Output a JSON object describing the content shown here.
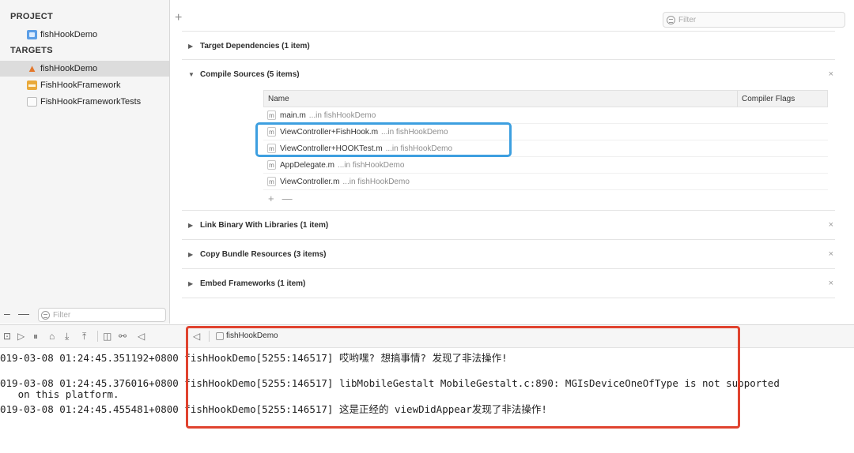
{
  "navigator": {
    "project_header": "PROJECT",
    "project_item": "fishHookDemo",
    "targets_header": "TARGETS",
    "targets": [
      {
        "label": "fishHookDemo",
        "icon": "app-target-icon"
      },
      {
        "label": "FishHookFramework",
        "icon": "framework-icon"
      },
      {
        "label": "FishHookFrameworkTests",
        "icon": "test-bundle-icon"
      }
    ],
    "filter_placeholder": "Filter"
  },
  "editor": {
    "add_symbol": "+",
    "filter_placeholder": "Filter",
    "phases": {
      "target_dependencies": "Target Dependencies (1 item)",
      "compile_sources": "Compile Sources (5 items)",
      "link_binary": "Link Binary With Libraries (1 item)",
      "copy_bundle": "Copy Bundle Resources (3 items)",
      "embed_frameworks": "Embed Frameworks (1 item)"
    },
    "close_symbol": "×",
    "table": {
      "col_name": "Name",
      "col_flags": "Compiler Flags",
      "rows": [
        {
          "file": "main.m",
          "location": "...in fishHookDemo"
        },
        {
          "file": "ViewController+FishHook.m",
          "location": "...in fishHookDemo"
        },
        {
          "file": "ViewController+HOOKTest.m",
          "location": "...in fishHookDemo"
        },
        {
          "file": "AppDelegate.m",
          "location": "...in fishHookDemo"
        },
        {
          "file": "ViewController.m",
          "location": "...in fishHookDemo"
        }
      ],
      "file_icon_glyph": "m",
      "add_symbol": "+",
      "remove_symbol": "—"
    }
  },
  "debug_bar": {
    "target": "fishHookDemo"
  },
  "console": {
    "lines": [
      "019-03-08 01:24:45.351192+0800 fishHookDemo[5255:146517] 哎哟嘿? 想搞事情? 发现了非法操作!",
      "019-03-08 01:24:45.376016+0800 fishHookDemo[5255:146517] libMobileGestalt MobileGestalt.c:890: MGIsDeviceOneOfType is not supported",
      "   on this platform.",
      "019-03-08 01:24:45.455481+0800 fishHookDemo[5255:146517] 这是正经的 viewDidAppear发现了非法操作!"
    ]
  },
  "colors": {
    "highlight_blue": "#3d9fe0",
    "highlight_red": "#e0432f",
    "selection_gray": "#dcdcdc"
  }
}
